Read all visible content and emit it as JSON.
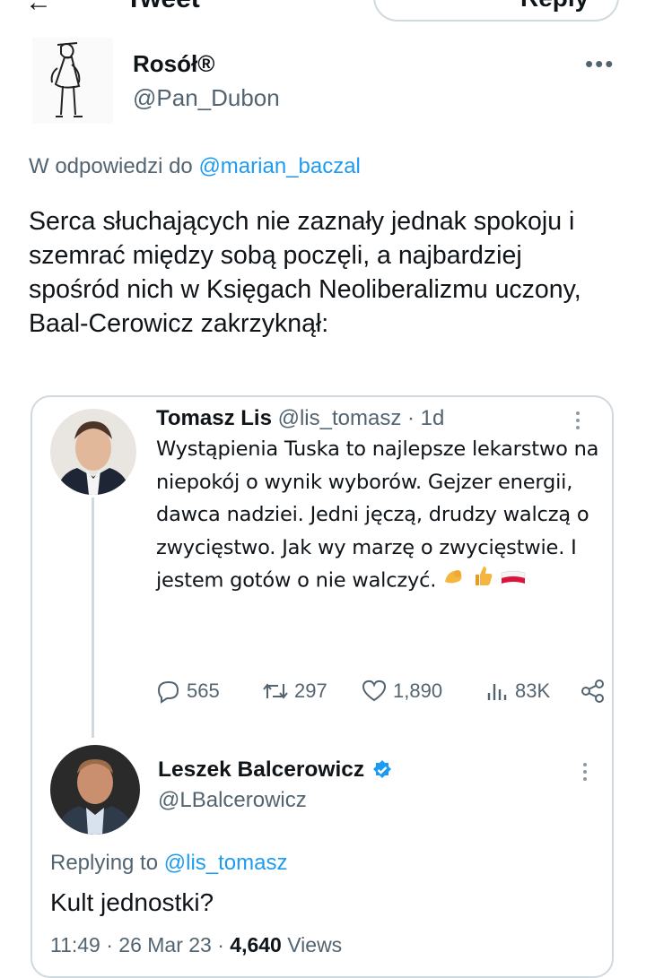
{
  "top_bar": {
    "back_icon": "arrow-left-icon",
    "title": "Tweet",
    "button_label": "Reply"
  },
  "tweet": {
    "author_name": "Rosół®",
    "author_handle": "@Pan_Dubon",
    "replying_prefix": "W odpowiedzi do ",
    "replying_handle": "@marian_baczal",
    "text": "Serca słuchających nie zaznały jednak spokoju i szemrać między sobą poczęli, a najbardziej spośród nich w Księgach Neoliberalizmu uczony, Baal-Cerowicz zakrzyknął:"
  },
  "quote": {
    "parent": {
      "name": "Tomasz Lis",
      "handle": "@lis_tomasz",
      "time": " · 1d",
      "text": "Wystąpienia Tuska to najlepsze lekarstwo na niepokój o wynik wyborów. Gejzer energii, dawca nadziei. Jedni jęczą, drudzy walczą o zwycięstwo. Jak wy marzę o zwycięstwie. I jestem gotów o nie walczyć.",
      "emojis": [
        "flexed-biceps-icon",
        "thumbs-up-icon",
        "poland-flag-icon"
      ],
      "replies": "565",
      "retweets": "297",
      "likes": "1,890",
      "views": "83K"
    },
    "reply": {
      "name": "Leszek Balcerowicz",
      "verified": true,
      "handle": "@LBalcerowicz",
      "replying_prefix": "Replying to ",
      "replying_handle": "@lis_tomasz",
      "text": "Kult jednostki?",
      "timestamp": "11:49 · 26 Mar 23 · ",
      "views_count": "4,640",
      "views_label": " Views"
    }
  },
  "colors": {
    "accent": "#1d9bf0",
    "secondary_text": "#536471",
    "border": "#cfd9de"
  }
}
